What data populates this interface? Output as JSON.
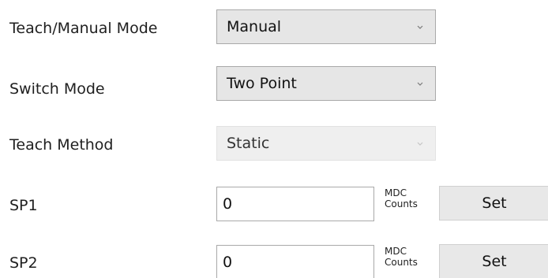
{
  "teach_manual_mode": {
    "label": "Teach/Manual Mode",
    "value": "Manual"
  },
  "switch_mode": {
    "label": "Switch Mode",
    "value": "Two Point"
  },
  "teach_method": {
    "label": "Teach Method",
    "value": "Static",
    "disabled": true
  },
  "sp1": {
    "label": "SP1",
    "value": "0",
    "unit_line1": "MDC",
    "unit_line2": "Counts",
    "button": "Set"
  },
  "sp2": {
    "label": "SP2",
    "value": "0",
    "unit_line1": "MDC",
    "unit_line2": "Counts",
    "button": "Set"
  },
  "icons": {
    "dropdown": "chevron-down-icon"
  }
}
